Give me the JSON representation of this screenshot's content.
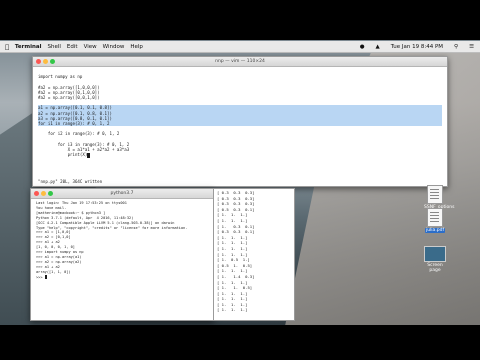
{
  "menubar": {
    "app": "Terminal",
    "items": [
      "Shell",
      "Edit",
      "View",
      "Window",
      "Help"
    ],
    "status": "Tue Jan 19  8:44 PM"
  },
  "editor": {
    "title": "nnp — vim — 110×24",
    "lines": [
      "",
      "import numpy as np",
      "",
      "#a2 = np.array([1,0,0,0])",
      "#a2 = np.array([0,1,0,0])",
      "#a2 = np.array([0,0,1,0])",
      "",
      "a1 = np.array([0.1, 0.1, 0.8])",
      "a2 = np.array([0.1, 0.8, 0.1])",
      "a3 = np.array([0.8, 0.1, 0.1])",
      "for i1 in range(3): # 0, 1, 2",
      "",
      "    for i2 in range(3): # 0, 1, 2",
      "",
      "        for i3 in range(3): # 0, 1, 2",
      "            X = a1*a1 + a2*a2 + a3*a3",
      "            print(X)",
      "",
      "",
      "",
      ""
    ],
    "status": "\"nnp.py\" 20L, 364C written"
  },
  "python_window": {
    "title": "python3.7",
    "lines": [
      "Last login: Thu Jan 19 17:53:25 on ttys001",
      "You have mail.",
      "[matherine@macbook:~ $ python3 ]",
      "Python 3.7.1 (default, Apr  4 2016, 11:48:32)",
      "[GCC 4.2.1 Compatible Apple LLVM 5.1 (clang-503.0.38)] on darwin",
      "Type \"help\", \"copyright\", \"credits\" or \"license\" for more information.",
      ">>> a1 = [1,0,0]",
      ">>> a2 = [0,1,0]",
      ">>> a1 + a2",
      "[1, 0, 0, 0, 1, 0]",
      ">>> import numpy as np",
      ">>> a1 = np.array(a1)",
      ">>> a2 = np.array(a2)",
      ">>> a1 + a2",
      "array([1, 1, 0])",
      ">>> "
    ]
  },
  "output_window": {
    "lines": [
      "[ 0.3  0.3  0.3]",
      "[ 0.3  0.3  0.3]",
      "[ 0.3  0.3  0.3]",
      "[ 0.5  0.3  0.1]",
      "[ 1.  1.  1.]",
      "[ 1.  1.  1.]",
      "[ 1.   0.3  0.1]",
      "[ 0.3  0.3  0.1]",
      "[ 1.  1.  1.]",
      "[ 1.  1.  1.]",
      "[ 1.  1.  1.]",
      "[ 1.  1.  1.]",
      "[ 1.  0.5  1.]",
      "[ 0.5  1.  0.5]",
      "[ 1.  1.  1.]",
      "[ 1.   1.4  0.3]",
      "[ 1.  1.  1.]",
      "[ 1.   1.  0.5]",
      "[ 1.  1.  1.]",
      "[ 1.  1.  1.]",
      "[ 1.  1.  1.]",
      "[ 1.  1.  1.]"
    ]
  },
  "desktop_icons": [
    {
      "label": "SSNF_options"
    },
    {
      "label": "julia.pdf"
    },
    {
      "label": "Screen page"
    }
  ],
  "colors": {
    "selection": "#b9d6f3",
    "close": "#fc5753",
    "minimize": "#fdbc40",
    "zoom": "#33c748"
  }
}
